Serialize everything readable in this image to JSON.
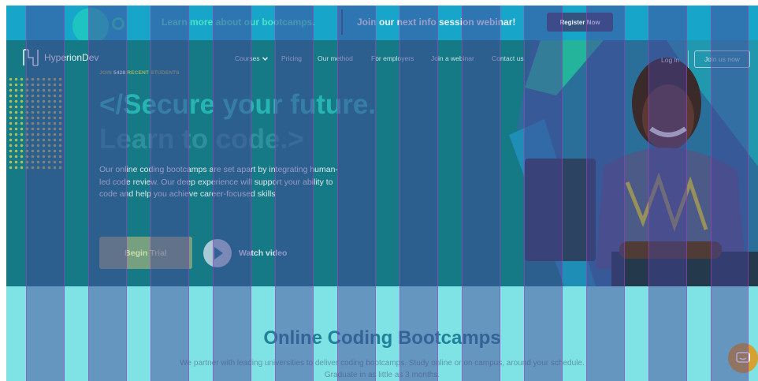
{
  "announcement": {
    "learn_more": "Learn more about our bootcamps.",
    "join_session": "Join our next info session webinar!",
    "register_label": "Register Now"
  },
  "brand": {
    "name": "HyperionDev"
  },
  "nav": {
    "items": [
      {
        "label": "Courses",
        "icon": "chevron-down-icon"
      },
      {
        "label": "Pricing"
      },
      {
        "label": "Our method"
      },
      {
        "label": "For employers"
      },
      {
        "label": "Join a webinar"
      },
      {
        "label": "Contact us"
      }
    ],
    "login_label": "Log in",
    "join_label": "Join us now"
  },
  "hero": {
    "eyebrow_prefix": "JOIN",
    "student_count": "5428",
    "eyebrow_suffix": "RECENT STUDENTS",
    "headline_line1": "</Secure your future.",
    "headline_line2": "Learn to code.>",
    "intro": "Our online coding bootcamps are set apart by integrating human-led code review. Our deep experience will support your ability to code and help you achieve career-focused skills",
    "trial_label": "Begin Trial",
    "watch_label": "Watch video"
  },
  "bootcamps": {
    "title": "Online Coding Bootcamps",
    "description": "We partner with leading universities to deliver coding bootcamps. Study online or on campus, around your schedule. Graduate in as little as 3 months."
  },
  "colors": {
    "announcement_bg": "#17a6c9",
    "hero_bg": "#157a86",
    "section_bg": "#7fe2e4",
    "accent_teal": "#27b4b3",
    "trial_button": "#77a081",
    "chat_button": "#d5a131"
  },
  "icons": {
    "logo": "hyperiondev-logo-icon",
    "play": "play-icon",
    "chat": "chat-icon"
  }
}
